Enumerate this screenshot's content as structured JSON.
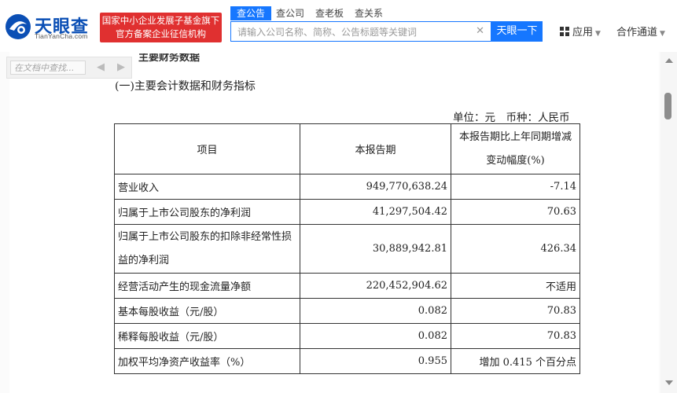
{
  "brand": {
    "name": "天眼查",
    "domain": "TianYanCha.com",
    "badge_line1": "国家中小企业发展子基金旗下",
    "badge_line2": "官方备案企业征信机构",
    "primary_color": "#1677ff",
    "badge_color": "#e03030"
  },
  "nav": {
    "tabs": [
      "查公告",
      "查公司",
      "查老板",
      "查关系"
    ],
    "active_tab": "查公告",
    "search_placeholder": "请输入公司名称、简称、公告标题等关键词",
    "search_button": "天眼一下",
    "app_label": "应用",
    "coop_label": "合作通道"
  },
  "viewer": {
    "find_placeholder": "在文档中查找...",
    "prev_icon": "left-arrow-icon",
    "next_icon": "right-arrow-icon"
  },
  "document": {
    "cut_heading": "主要财务数据",
    "section_title": "(一)主要会计数据和财务指标",
    "unit_line": "单位：元　币种：人民币",
    "table": {
      "headers": [
        "项目",
        "本报告期",
        "本报告期比上年同期增减变动幅度(%)"
      ],
      "rows": [
        {
          "item": "营业收入",
          "value": "949,770,638.24",
          "change": "-7.14"
        },
        {
          "item": "归属于上市公司股东的净利润",
          "value": "41,297,504.42",
          "change": "70.63"
        },
        {
          "item": "归属于上市公司股东的扣除非经常性损益的净利润",
          "value": "30,889,942.81",
          "change": "426.34"
        },
        {
          "item": "经营活动产生的现金流量净额",
          "value": "220,452,904.62",
          "change": "不适用"
        },
        {
          "item": "基本每股收益（元/股）",
          "value": "0.082",
          "change": "70.83"
        },
        {
          "item": "稀释每股收益（元/股）",
          "value": "0.082",
          "change": "70.83"
        },
        {
          "item": "加权平均净资产收益率（%）",
          "value": "0.955",
          "change": "增加 0.415 个百分点"
        }
      ]
    }
  }
}
